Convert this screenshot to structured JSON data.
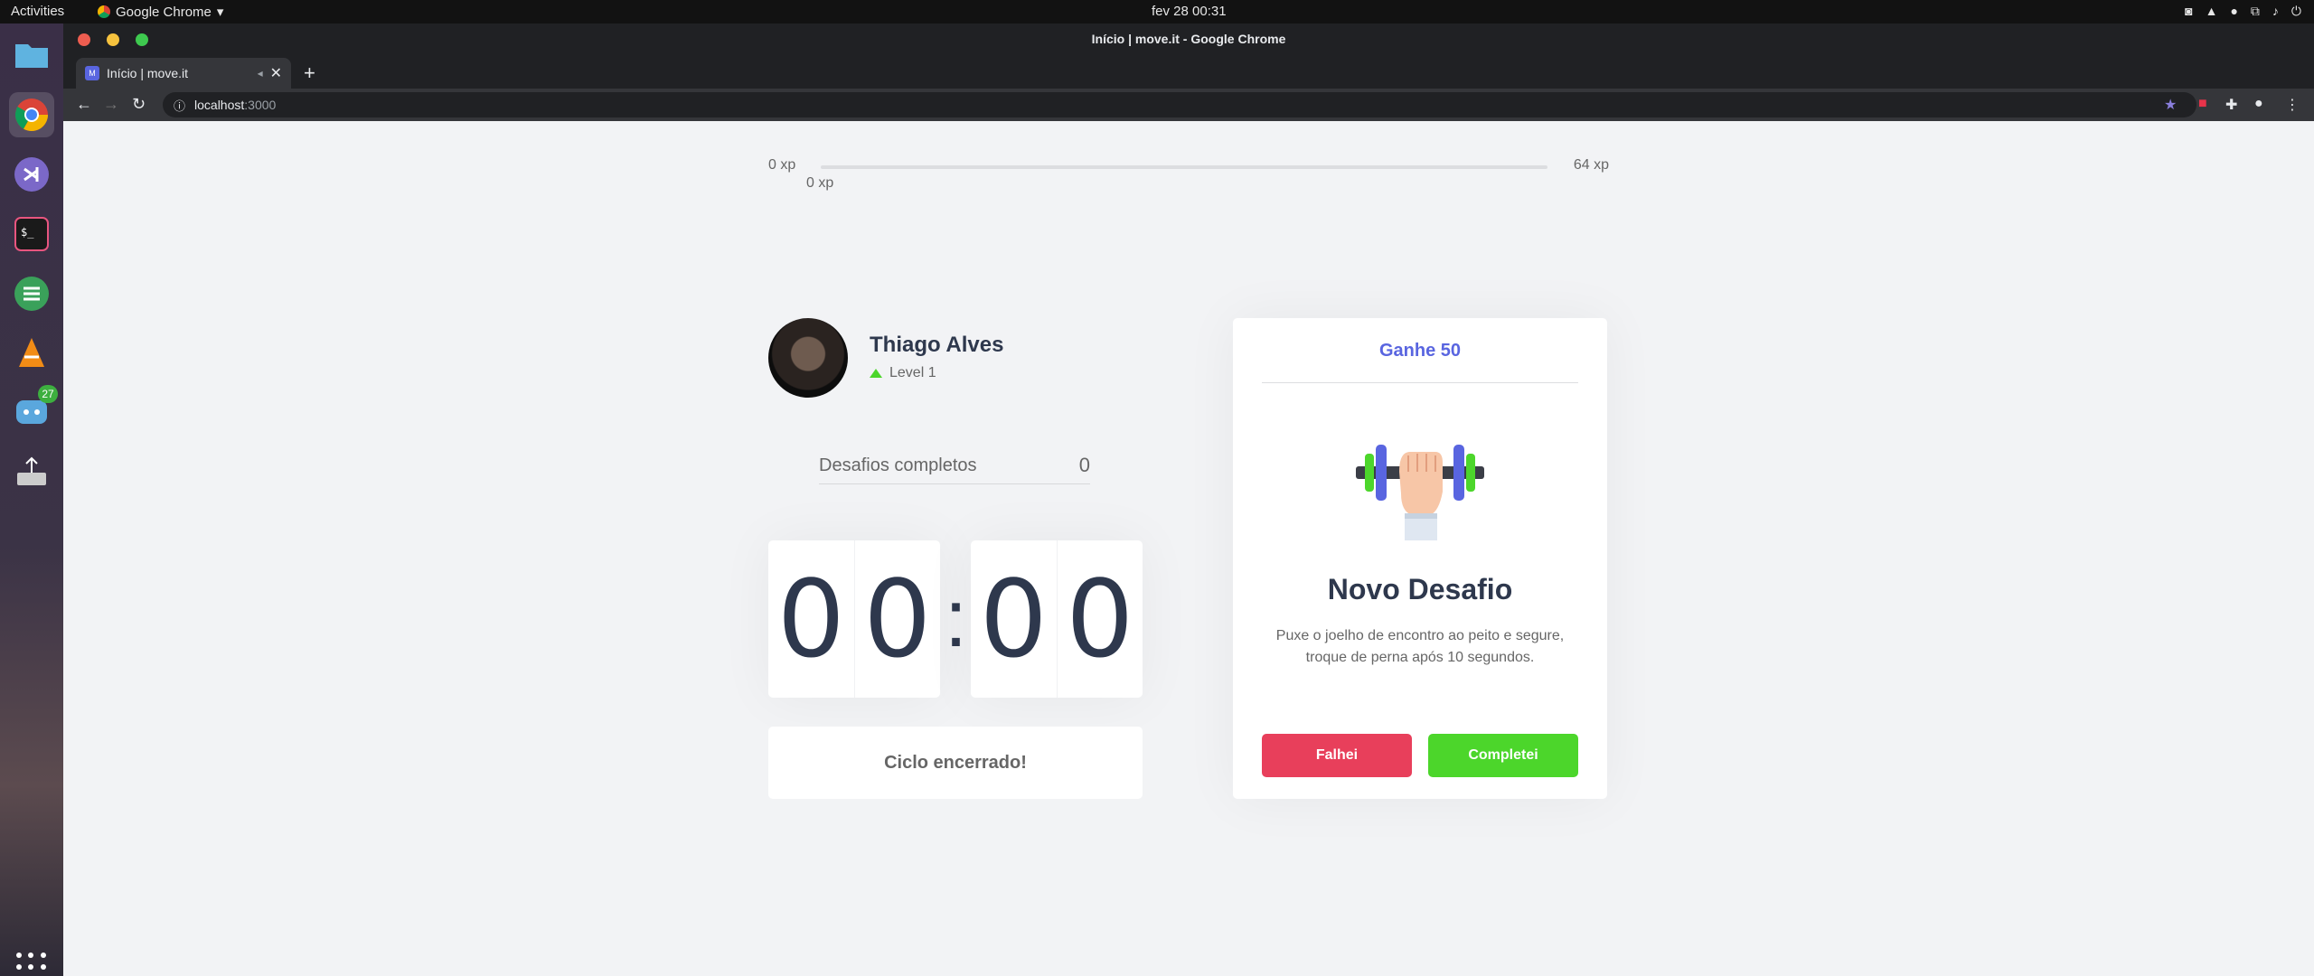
{
  "os": {
    "activities": "Activities",
    "app_menu": "Google Chrome",
    "clock": "fev 28  00:31",
    "tray_icons": [
      "discord-icon",
      "vlc-icon",
      "grammarly-icon",
      "network-icon",
      "volume-icon",
      "power-icon"
    ],
    "dock": [
      {
        "name": "files-icon"
      },
      {
        "name": "chrome-icon"
      },
      {
        "name": "vscode-icon"
      },
      {
        "name": "terminal-icon"
      },
      {
        "name": "notes-icon"
      },
      {
        "name": "vlc-icon"
      },
      {
        "name": "discord-icon",
        "badge": "27"
      },
      {
        "name": "usb-drive-icon"
      }
    ]
  },
  "browser": {
    "window_title": "Início | move.it - Google Chrome",
    "tab_title": "Início | move.it",
    "url_host": "localhost",
    "url_port": ":3000"
  },
  "app": {
    "xp": {
      "min_label": "0 xp",
      "max_label": "64 xp",
      "current_label": "0 xp",
      "progress": 0
    },
    "profile": {
      "name": "Thiago Alves",
      "level": "Level 1"
    },
    "completed": {
      "label": "Desafios completos",
      "count": "0"
    },
    "countdown": {
      "minute_left": "0",
      "minute_right": "0",
      "separator": ":",
      "second_left": "0",
      "second_right": "0"
    },
    "cycle_button": "Ciclo encerrado!",
    "challenge": {
      "header": "Ganhe 50",
      "title": "Novo Desafio",
      "description": "Puxe o joelho de encontro ao peito e segure, troque de perna após 10 segundos.",
      "fail_button": "Falhei",
      "success_button": "Completei"
    }
  },
  "colors": {
    "accent": "#5965e0",
    "success": "#4cd62b",
    "danger": "#e83f5b",
    "title": "#2e384d",
    "background": "#f2f3f5"
  }
}
